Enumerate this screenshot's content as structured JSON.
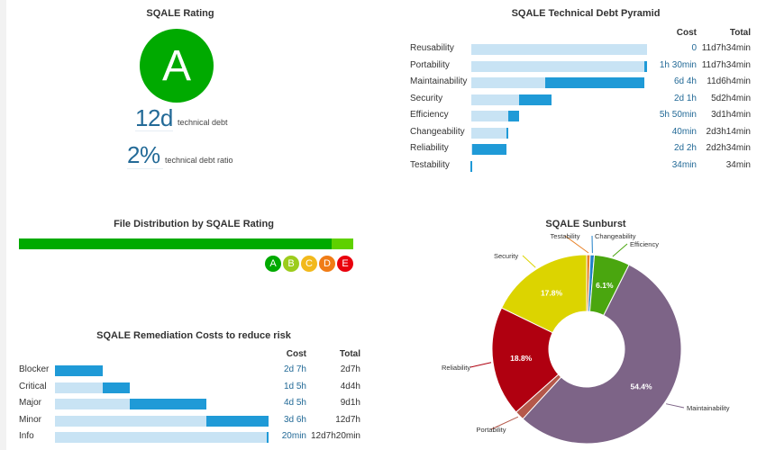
{
  "rating_widget": {
    "title": "SQALE Rating",
    "rating": "A",
    "rating_color": "#00aa00",
    "technical_debt_value": "12d",
    "technical_debt_label": "technical debt",
    "debt_ratio_value": "2%",
    "debt_ratio_label": "technical debt ratio"
  },
  "pyramid": {
    "title": "SQALE Technical Debt Pyramid",
    "cost_header": "Cost",
    "total_header": "Total",
    "max_total_minutes": 5534,
    "rows": [
      {
        "label": "Reusability",
        "cost": "0",
        "total": "11d7h34min",
        "cost_minutes": 0,
        "total_minutes": 5534
      },
      {
        "label": "Portability",
        "cost": "1h 30min",
        "total": "11d7h34min",
        "cost_minutes": 90,
        "total_minutes": 5534
      },
      {
        "label": "Maintainability",
        "cost": "6d 4h",
        "total": "11d6h4min",
        "cost_minutes": 3120,
        "total_minutes": 5444
      },
      {
        "label": "Security",
        "cost": "2d 1h",
        "total": "5d2h4min",
        "cost_minutes": 1020,
        "total_minutes": 2524
      },
      {
        "label": "Efficiency",
        "cost": "5h 50min",
        "total": "3d1h4min",
        "cost_minutes": 350,
        "total_minutes": 1504
      },
      {
        "label": "Changeability",
        "cost": "40min",
        "total": "2d3h14min",
        "cost_minutes": 40,
        "total_minutes": 1154
      },
      {
        "label": "Reliability",
        "cost": "2d 2h",
        "total": "2d2h34min",
        "cost_minutes": 1080,
        "total_minutes": 1114
      },
      {
        "label": "Testability",
        "cost": "34min",
        "total": "34min",
        "cost_minutes": 34,
        "total_minutes": 34
      }
    ]
  },
  "file_distribution": {
    "title": "File Distribution by SQALE Rating",
    "segments": [
      {
        "rating": "A",
        "percent": 93.5,
        "color": "#00aa00"
      },
      {
        "rating": "B",
        "percent": 6.5,
        "color": "#5fd100"
      }
    ],
    "legend": [
      {
        "rating": "A",
        "color": "#00aa00"
      },
      {
        "rating": "B",
        "color": "#9ccc1c"
      },
      {
        "rating": "C",
        "color": "#f2b91c"
      },
      {
        "rating": "D",
        "color": "#f07c16"
      },
      {
        "rating": "E",
        "color": "#e9000d"
      }
    ]
  },
  "remediation": {
    "title": "SQALE Remediation Costs to reduce risk",
    "cost_header": "Cost",
    "total_header": "Total",
    "max_total_minutes": 6180,
    "rows": [
      {
        "label": "Blocker",
        "cost": "2d 7h",
        "total": "2d7h",
        "cost_minutes": 1380,
        "total_minutes": 1380
      },
      {
        "label": "Critical",
        "cost": "1d 5h",
        "total": "4d4h",
        "cost_minutes": 780,
        "total_minutes": 2160
      },
      {
        "label": "Major",
        "cost": "4d 5h",
        "total": "9d1h",
        "cost_minutes": 2220,
        "total_minutes": 4380
      },
      {
        "label": "Minor",
        "cost": "3d 6h",
        "total": "12d7h",
        "cost_minutes": 1800,
        "total_minutes": 6180
      },
      {
        "label": "Info",
        "cost": "20min",
        "total": "12d7h20min",
        "cost_minutes": 20,
        "total_minutes": 6200
      }
    ]
  },
  "sunburst": {
    "title": "SQALE Sunburst",
    "slices": [
      {
        "label": "Testability",
        "percent": 0.6,
        "color": "#e8832a",
        "show_value": false
      },
      {
        "label": "Changeability",
        "percent": 0.7,
        "color": "#1f80c8",
        "show_value": false
      },
      {
        "label": "Efficiency",
        "percent": 6.1,
        "color": "#4aa60f",
        "show_value": true,
        "value_label": "6.1%"
      },
      {
        "label": "Maintainability",
        "percent": 54.4,
        "color": "#7d6487",
        "show_value": true,
        "value_label": "54.4%"
      },
      {
        "label": "Portability",
        "percent": 1.6,
        "color": "#b5584a",
        "show_value": false
      },
      {
        "label": "Reliability",
        "percent": 18.8,
        "color": "#b00010",
        "show_value": true,
        "value_label": "18.8%"
      },
      {
        "label": "Security",
        "percent": 17.8,
        "color": "#dcd400",
        "show_value": true,
        "value_label": "17.8%"
      }
    ]
  }
}
